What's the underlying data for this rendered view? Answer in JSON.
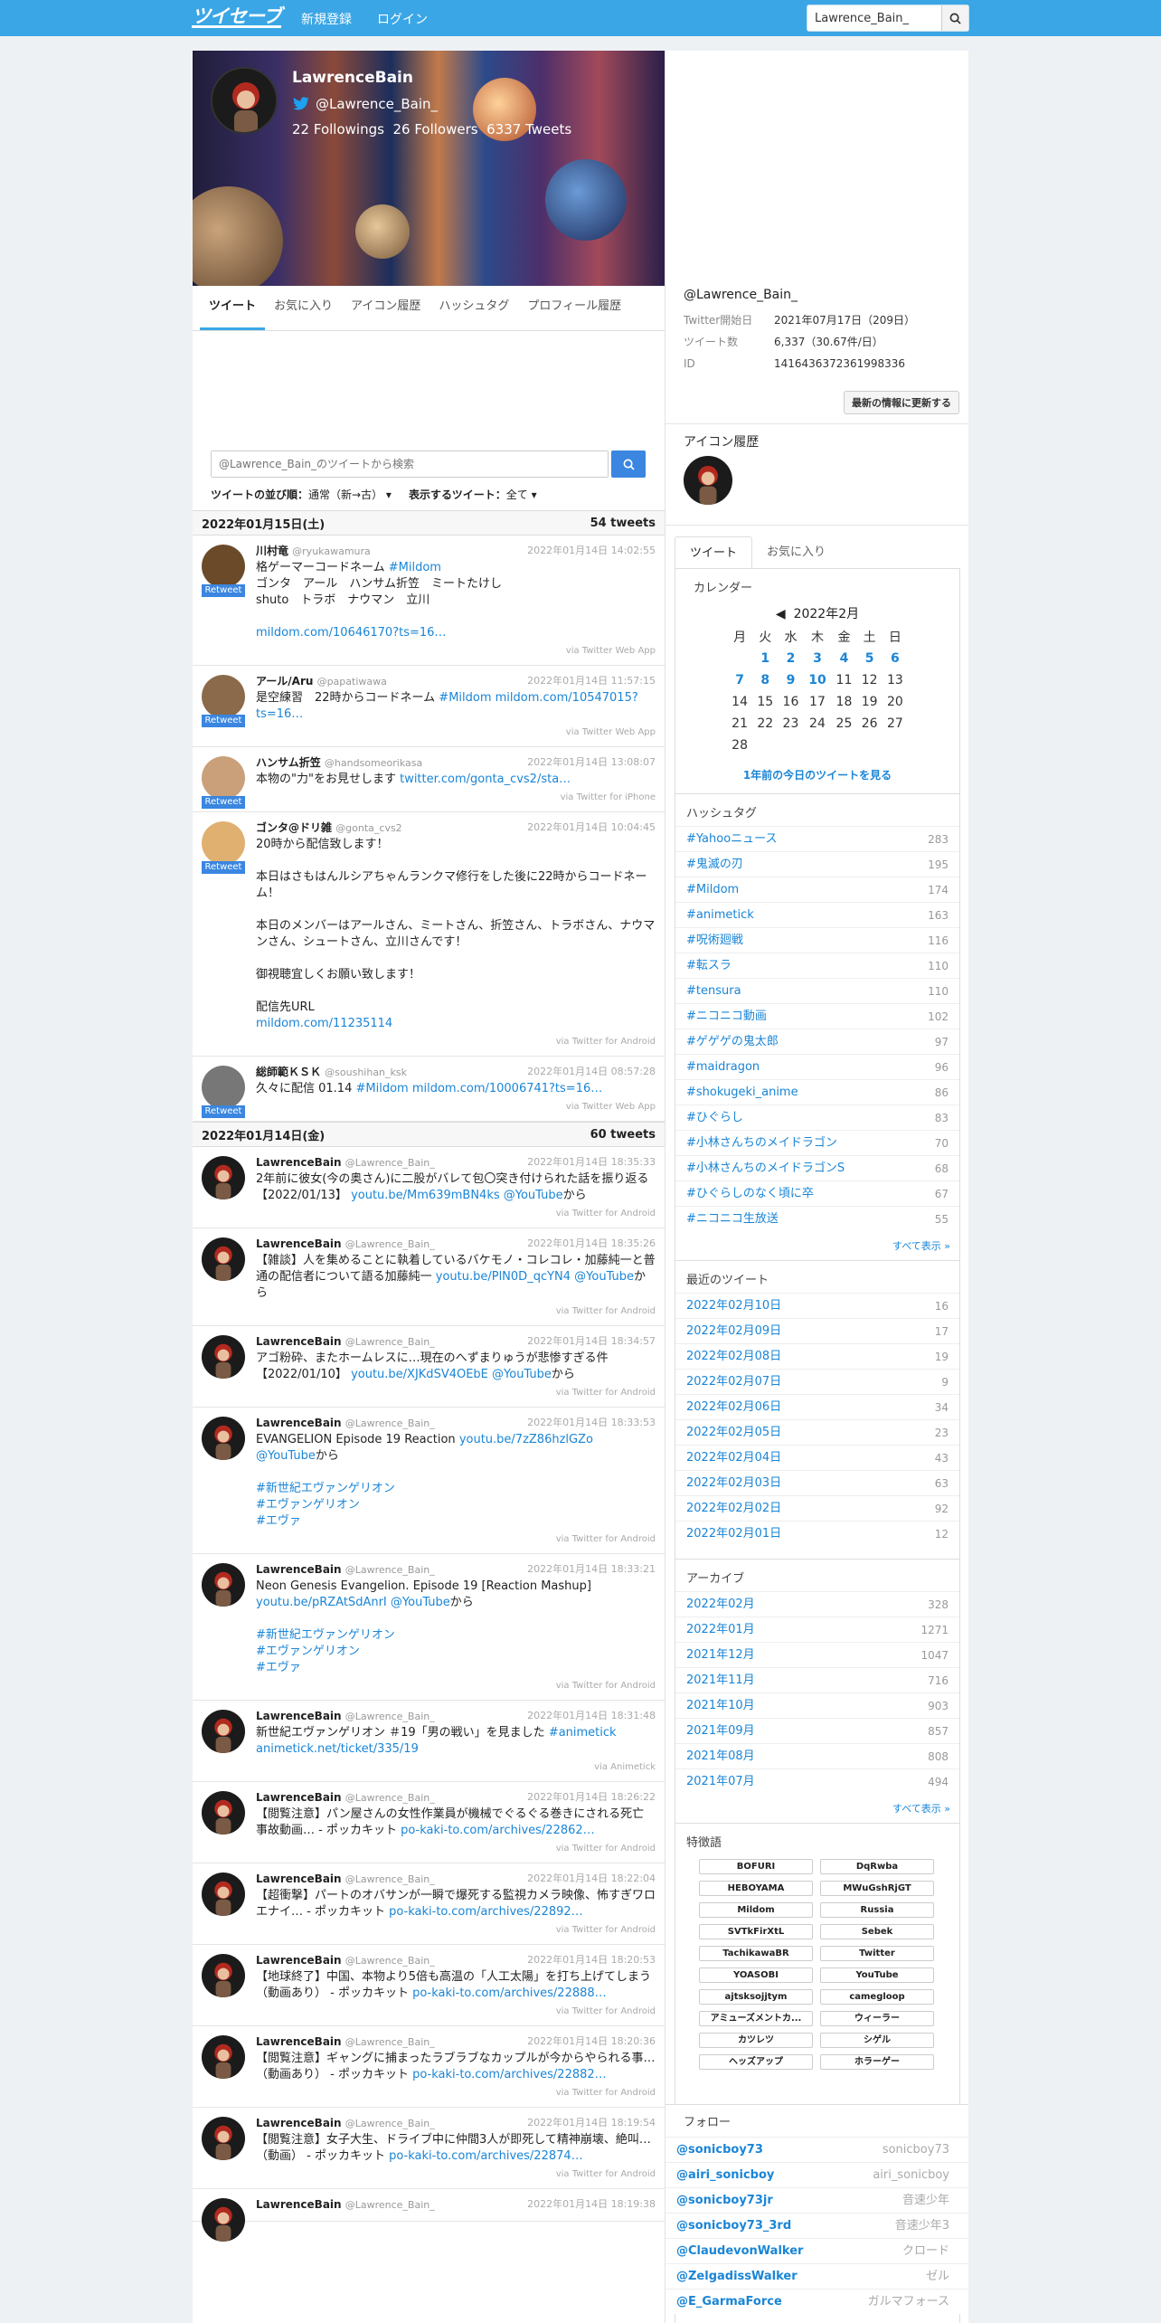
{
  "header": {
    "logo": "ツイセーブ",
    "signup": "新規登録",
    "login": "ログイン",
    "search_value": "Lawrence_Bain_"
  },
  "profile": {
    "name": "LawrenceBain",
    "handle": "@Lawrence_Bain_",
    "followings": "22 Followings",
    "followers": "26 Followers",
    "tweets": "6337 Tweets"
  },
  "tabs": [
    "ツイート",
    "お気に入り",
    "アイコン履歴",
    "ハッシュタグ",
    "プロフィール履歴"
  ],
  "tweet_search_placeholder": "@Lawrence_Bain_のツイートから検索",
  "sort": {
    "label": "ツイートの並び順：",
    "value": "通常（新→古）",
    "show_label": "表示するツイート：",
    "show_value": "全て"
  },
  "days": [
    {
      "date": "2022年01月15日(土)",
      "count": "54 tweets",
      "tweets": [
        {
          "name": "川村竜",
          "handle": "@ryukawamura",
          "time": "2022年01月14日 14:02:55",
          "rt": "Retweet",
          "body": "格ゲーマーコードネーム #Mildom\nゴンタ　アール　ハンサム折笠　ミートたけし\nshuto　トラボ　ナウマン　立川\n\nmildom.com/10646170?ts=16…",
          "via": "via Twitter Web App",
          "av": "#6b4a2a"
        },
        {
          "name": "アール/Aru",
          "handle": "@papatiwawa",
          "time": "2022年01月14日 11:57:15",
          "rt": "Retweet",
          "body": "是空練習　22時からコードネーム #Mildom mildom.com/10547015?ts=16…",
          "via": "via Twitter Web App",
          "av": "#8a6a4a"
        },
        {
          "name": "ハンサム折笠",
          "handle": "@handsomeorikasa",
          "time": "2022年01月14日 13:08:07",
          "rt": "Retweet",
          "body": "本物の\"力\"をお見せします twitter.com/gonta_cvs2/sta…",
          "via": "via Twitter for iPhone",
          "av": "#c9a07a"
        },
        {
          "name": "ゴンタ@ドリ雑",
          "handle": "@gonta_cvs2",
          "time": "2022年01月14日 10:04:45",
          "rt": "Retweet",
          "body": "20時から配信致します！\n\n本日はさもはんルシアちゃんランクマ修行をした後に22時からコードネーム！\n\n本日のメンバーはアールさん、ミートさん、折笠さん、トラボさん、ナウマンさん、シュートさん、立川さんです！\n\n御視聴宜しくお願い致します！\n\n配信先URL\nmildom.com/11235114",
          "via": "via Twitter for Android",
          "av": "#e0b070"
        },
        {
          "name": "総師範ＫＳＫ",
          "handle": "@soushihan_ksk",
          "time": "2022年01月14日 08:57:28",
          "rt": "Retweet",
          "body": "久々に配信 01.14 #Mildom mildom.com/10006741?ts=16…",
          "via": "via Twitter Web App",
          "av": "#777"
        }
      ]
    },
    {
      "date": "2022年01月14日(金)",
      "count": "60 tweets",
      "tweets": [
        {
          "name": "LawrenceBain",
          "handle": "@Lawrence_Bain_",
          "time": "2022年01月14日 18:35:33",
          "body": "2年前に彼女(今の奥さん)に二股がバレて包〇突き付けられた話を振り返る【2022/01/13】 youtu.be/Mm639mBN4ks @YouTubeから",
          "via": "via Twitter for Android"
        },
        {
          "name": "LawrenceBain",
          "handle": "@Lawrence_Bain_",
          "time": "2022年01月14日 18:35:26",
          "body": "【雑談】人を集めることに執着しているバケモノ・コレコレ・加藤純一と普通の配信者について語る加藤純一 youtu.be/PlN0D_qcYN4 @YouTubeから",
          "via": "via Twitter for Android"
        },
        {
          "name": "LawrenceBain",
          "handle": "@Lawrence_Bain_",
          "time": "2022年01月14日 18:34:57",
          "body": "アゴ粉砕、またホームレスに…現在のへずまりゅうが悲惨すぎる件【2022/01/10】 youtu.be/XJKdSV4OEbE @YouTubeから",
          "via": "via Twitter for Android"
        },
        {
          "name": "LawrenceBain",
          "handle": "@Lawrence_Bain_",
          "time": "2022年01月14日 18:33:53",
          "body": "EVANGELION Episode 19 Reaction youtu.be/7zZ86hzlGZo @YouTubeから\n\n#新世紀エヴァンゲリオン\n#エヴァンゲリオン\n#エヴァ",
          "via": "via Twitter for Android"
        },
        {
          "name": "LawrenceBain",
          "handle": "@Lawrence_Bain_",
          "time": "2022年01月14日 18:33:21",
          "body": "Neon Genesis Evangelion. Episode 19 [Reaction Mashup] youtu.be/pRZAtSdAnrI @YouTubeから\n\n#新世紀エヴァンゲリオン\n#エヴァンゲリオン\n#エヴァ",
          "via": "via Twitter for Android"
        },
        {
          "name": "LawrenceBain",
          "handle": "@Lawrence_Bain_",
          "time": "2022年01月14日 18:31:48",
          "body": "新世紀エヴァンゲリオン ＃19「男の戦い」を見ました #animetick animetick.net/ticket/335/19",
          "via": "via Animetick"
        },
        {
          "name": "LawrenceBain",
          "handle": "@Lawrence_Bain_",
          "time": "2022年01月14日 18:26:22",
          "body": "【閲覧注意】パン屋さんの女性作業員が機械でぐるぐる巻きにされる死亡事故動画… - ポッカキット po-kaki-to.com/archives/22862…",
          "via": "via Twitter for Android"
        },
        {
          "name": "LawrenceBain",
          "handle": "@Lawrence_Bain_",
          "time": "2022年01月14日 18:22:04",
          "body": "【超衝撃】パートのオバサンが一瞬で爆死する監視カメラ映像、怖すぎワロエナイ… - ポッカキット po-kaki-to.com/archives/22892…",
          "via": "via Twitter for Android"
        },
        {
          "name": "LawrenceBain",
          "handle": "@Lawrence_Bain_",
          "time": "2022年01月14日 18:20:53",
          "body": "【地球終了】中国、本物より5倍も高温の「人工太陽」を打ち上げてしまう（動画あり） - ポッカキット po-kaki-to.com/archives/22888…",
          "via": "via Twitter for Android"
        },
        {
          "name": "LawrenceBain",
          "handle": "@Lawrence_Bain_",
          "time": "2022年01月14日 18:20:36",
          "body": "【閲覧注意】ギャングに捕まったラブラブなカップルが今からやられる事…（動画あり） - ポッカキット po-kaki-to.com/archives/22882…",
          "via": "via Twitter for Android"
        },
        {
          "name": "LawrenceBain",
          "handle": "@Lawrence_Bain_",
          "time": "2022年01月14日 18:19:54",
          "body": "【閲覧注意】女子大生、ドライブ中に仲間3人が即死して精神崩壊、絶叫…（動画） - ポッカキット po-kaki-to.com/archives/22874…",
          "via": "via Twitter for Android"
        },
        {
          "name": "LawrenceBain",
          "handle": "@Lawrence_Bain_",
          "time": "2022年01月14日 18:19:38",
          "body": "",
          "via": ""
        }
      ]
    }
  ],
  "right": {
    "handle": "@Lawrence_Bain_",
    "info": [
      {
        "k": "Twitter開始日",
        "v": "2021年07月17日（209日）"
      },
      {
        "k": "ツイート数",
        "v": "6,337（30.67件/日）"
      },
      {
        "k": "ID",
        "v": "1416436372361998336"
      }
    ],
    "update_btn": "最新の情報に更新する",
    "icon_history": "アイコン履歴",
    "tabs": [
      "ツイート",
      "お気に入り"
    ],
    "calendar": {
      "title": "カレンダー",
      "month": "2022年2月",
      "prev": "◀",
      "weekdays": [
        "月",
        "火",
        "水",
        "木",
        "金",
        "土",
        "日"
      ],
      "rows": [
        [
          "",
          "1",
          "2",
          "3",
          "4",
          "5",
          "6"
        ],
        [
          "7",
          "8",
          "9",
          "10",
          "11",
          "12",
          "13"
        ],
        [
          "14",
          "15",
          "16",
          "17",
          "18",
          "19",
          "20"
        ],
        [
          "21",
          "22",
          "23",
          "24",
          "25",
          "26",
          "27"
        ],
        [
          "28",
          "",
          "",
          "",
          "",
          "",
          ""
        ]
      ],
      "linked": [
        "1",
        "2",
        "3",
        "4",
        "5",
        "6",
        "7",
        "8",
        "9",
        "10"
      ],
      "year_ago": "1年前の今日のツイートを見る"
    },
    "hashtags_title": "ハッシュタグ",
    "hashtags": [
      [
        "#Yahooニュース",
        "283"
      ],
      [
        "#鬼滅の刃",
        "195"
      ],
      [
        "#Mildom",
        "174"
      ],
      [
        "#animetick",
        "163"
      ],
      [
        "#呪術廻戦",
        "116"
      ],
      [
        "#転スラ",
        "110"
      ],
      [
        "#tensura",
        "110"
      ],
      [
        "#ニコニコ動画",
        "102"
      ],
      [
        "#ゲゲゲの鬼太郎",
        "97"
      ],
      [
        "#maidragon",
        "96"
      ],
      [
        "#shokugeki_anime",
        "86"
      ],
      [
        "#ひぐらし",
        "83"
      ],
      [
        "#小林さんちのメイドラゴン",
        "70"
      ],
      [
        "#小林さんちのメイドラゴンS",
        "68"
      ],
      [
        "#ひぐらしのなく頃に卒",
        "67"
      ],
      [
        "#ニコニコ生放送",
        "55"
      ]
    ],
    "show_all": "すべて表示 »",
    "recent_title": "最近のツイート",
    "recent": [
      [
        "2022年02月10日",
        "16"
      ],
      [
        "2022年02月09日",
        "17"
      ],
      [
        "2022年02月08日",
        "19"
      ],
      [
        "2022年02月07日",
        "9"
      ],
      [
        "2022年02月06日",
        "34"
      ],
      [
        "2022年02月05日",
        "23"
      ],
      [
        "2022年02月04日",
        "43"
      ],
      [
        "2022年02月03日",
        "63"
      ],
      [
        "2022年02月02日",
        "92"
      ],
      [
        "2022年02月01日",
        "12"
      ]
    ],
    "archive_title": "アーカイブ",
    "archive": [
      [
        "2022年02月",
        "328"
      ],
      [
        "2022年01月",
        "1271"
      ],
      [
        "2021年12月",
        "1047"
      ],
      [
        "2021年11月",
        "716"
      ],
      [
        "2021年10月",
        "903"
      ],
      [
        "2021年09月",
        "857"
      ],
      [
        "2021年08月",
        "808"
      ],
      [
        "2021年07月",
        "494"
      ]
    ],
    "words_title": "特徴語",
    "words": [
      "BOFURI",
      "DqRwba",
      "HEBOYAMA",
      "MWuGshRjGT",
      "Mildom",
      "Russia",
      "SVTkFirXtL",
      "Sebek",
      "TachikawaBR",
      "Twitter",
      "YOASOBI",
      "YouTube",
      "ajtsksojjtym",
      "camegloop",
      "アミューズメントカ...",
      "ウィーラー",
      "カツレツ",
      "シゲル",
      "ヘッズアップ",
      "ホラーゲー"
    ],
    "follow_title": "フォロー",
    "follows": [
      [
        "@sonicboy73",
        "sonicboy73"
      ],
      [
        "@airi_sonicboy",
        "airi_sonicboy"
      ],
      [
        "@sonicboy73jr",
        "音速少年"
      ],
      [
        "@sonicboy73_3rd",
        "音速少年3"
      ],
      [
        "@ClaudevonWalker",
        "クロード"
      ],
      [
        "@ZelgadissWalker",
        "ゼル"
      ],
      [
        "@E_GarmaForce",
        "ガルマフォース"
      ]
    ]
  }
}
